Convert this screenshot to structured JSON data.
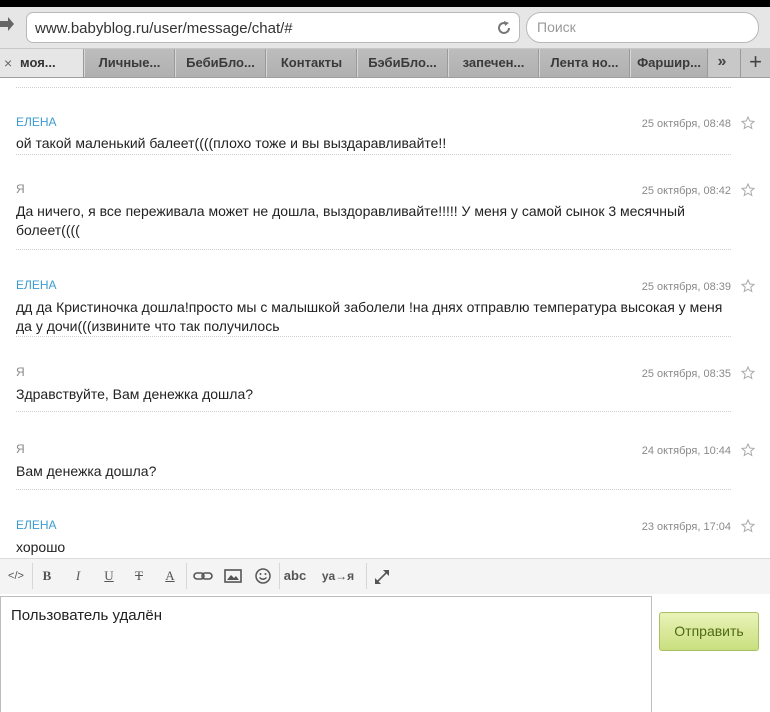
{
  "browser": {
    "url": "www.babyblog.ru/user/message/chat/#",
    "search_placeholder": "Поиск",
    "tabs": [
      {
        "label": "моя..."
      },
      {
        "label": "Личные..."
      },
      {
        "label": "БебиБло..."
      },
      {
        "label": "Контакты"
      },
      {
        "label": "БэбиБло..."
      },
      {
        "label": "запечен..."
      },
      {
        "label": "Лента но..."
      },
      {
        "label": "Фаршир..."
      }
    ],
    "tab_overflow": "»",
    "new_tab": "+",
    "close_tab": "×"
  },
  "messages": [
    {
      "author": "ЕЛЕНА",
      "date": "25 октября, 08:48",
      "text": "ой такой маленький балеет((((плохо тоже и вы выздаравливайте!!"
    },
    {
      "author": "Я",
      "date": "25 октября, 08:42",
      "text": "Да ничего, я все переживала может не дошла, выздоравливайте!!!!! У меня у самой сынок 3 месячный болеет(((("
    },
    {
      "author": "ЕЛЕНА",
      "date": "25 октября, 08:39",
      "text": "дд да Кристиночка дошла!просто мы с малышкой заболели !на днях отправлю температура высокая у меня да у дочи(((извините что так получилось"
    },
    {
      "author": "Я",
      "date": "25 октября, 08:35",
      "text": "Здравствуйте, Вам денежка дошла?"
    },
    {
      "author": "Я",
      "date": "24 октября, 10:44",
      "text": "Вам денежка дошла?"
    },
    {
      "author": "ЕЛЕНА",
      "date": "23 октября, 17:04",
      "text": "хорошо"
    }
  ],
  "toolbar": {
    "code": "</>",
    "bold": "B",
    "italic": "I",
    "underline": "U",
    "strike": "T",
    "color": "A",
    "spell": "abc",
    "translit": "ya→я"
  },
  "compose": {
    "value": "Пользователь удалён",
    "send_label": "Отправить"
  }
}
